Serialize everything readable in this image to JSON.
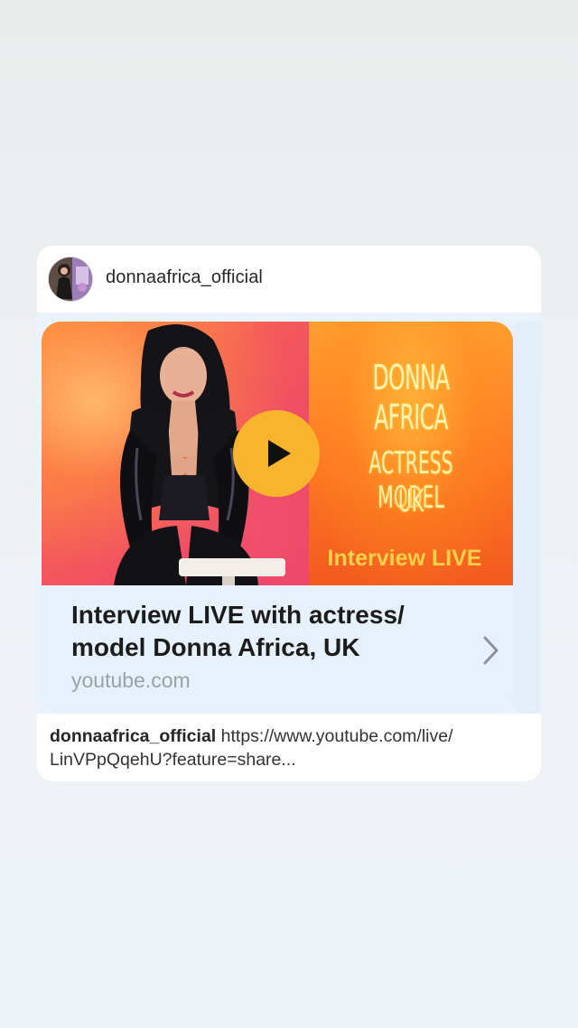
{
  "post": {
    "username": "donnaafrica_official",
    "avatar_icon": "profile-photo"
  },
  "link_preview": {
    "thumbnail": {
      "title": "DONNA AFRICA",
      "subtitle_line1": "ACTRESS MODEL",
      "subtitle_line2": "UK",
      "badge": "Interview LIVE",
      "play_icon": "play-icon"
    },
    "title": "Interview LIVE with actress/ model Donna Africa, UK",
    "domain": "youtube.com",
    "chevron_icon": "chevron-right-icon"
  },
  "caption": {
    "username": "donnaafrica_official",
    "text": "https://www.youtube.com/live/ LinVPpQqehU?feature=share..."
  },
  "colors": {
    "accent_play": "#f7b42c",
    "link_bg": "#e7f1fb",
    "thumb_text": "#fff3b0",
    "badge_text": "#ffd04a"
  }
}
